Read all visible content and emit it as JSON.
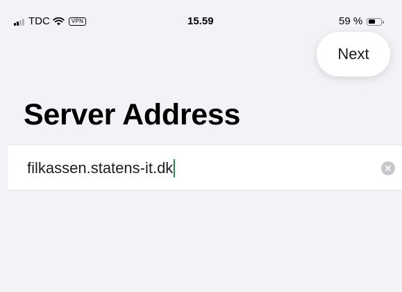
{
  "status_bar": {
    "carrier": "TDC",
    "vpn_label": "VPN",
    "time": "15.59",
    "battery_text": "59 %",
    "battery_level": 0.59
  },
  "toolbar": {
    "next_label": "Next"
  },
  "page": {
    "title": "Server Address"
  },
  "server_field": {
    "value": "filkassen.statens-it.dk",
    "clear_icon": "clear-circle-icon"
  },
  "colors": {
    "background": "#f2f2f7",
    "field_background": "#ffffff",
    "caret": "#1f8a4c",
    "clear_icon": "#c7c7cc"
  }
}
